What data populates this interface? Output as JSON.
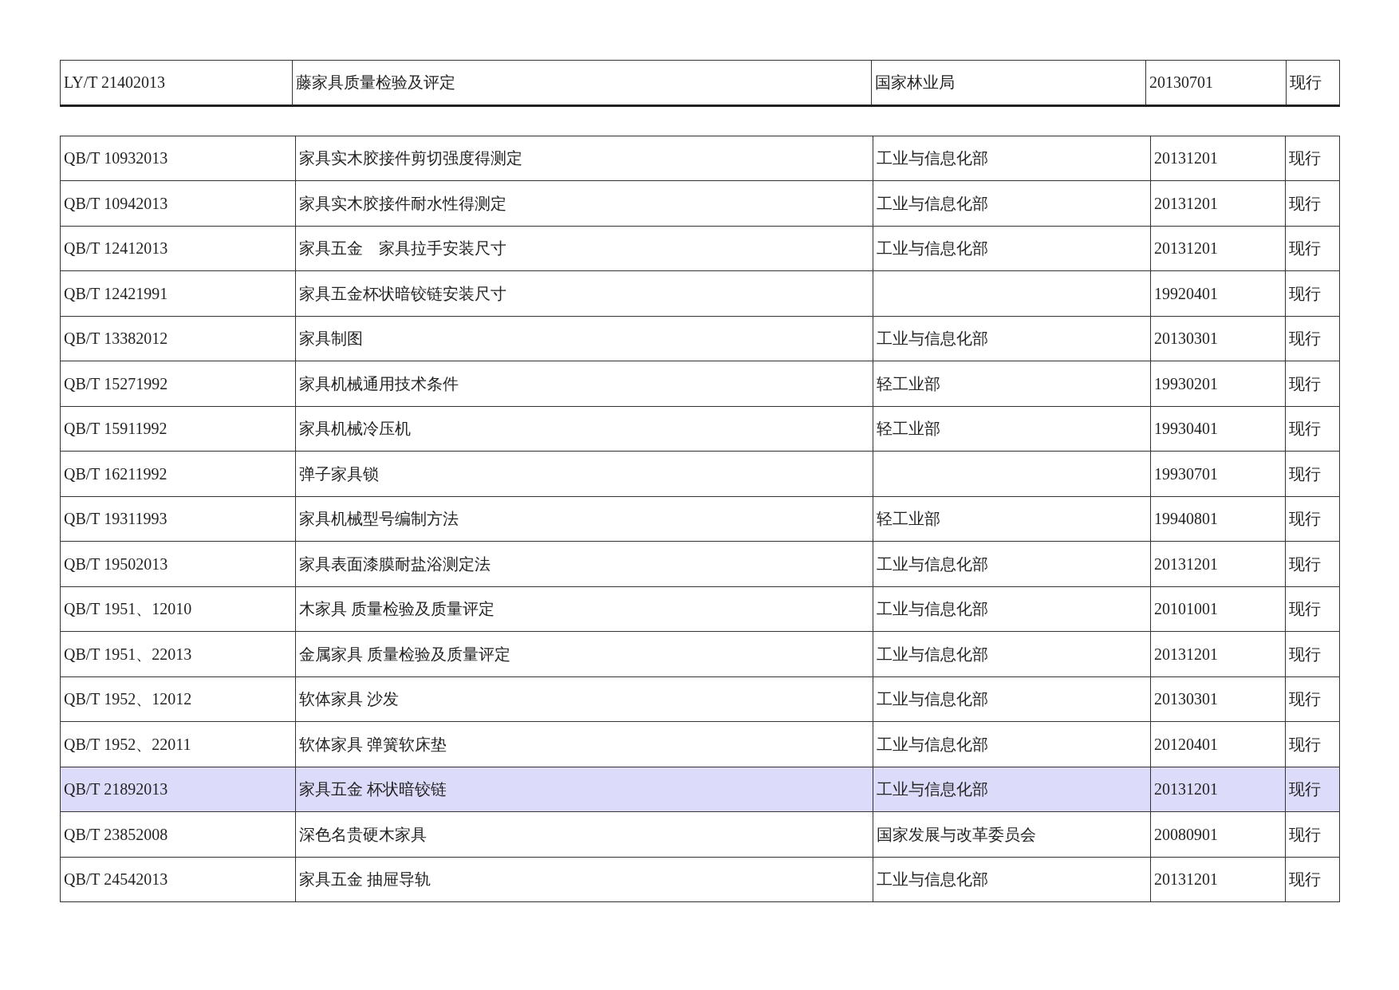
{
  "top_table": {
    "rows": [
      {
        "code": "LY/T 21402013",
        "title": "藤家具质量检验及评定",
        "department": "国家林业局",
        "date": "20130701",
        "status": "现行"
      }
    ]
  },
  "table": {
    "rows": [
      {
        "code": "QB/T 10932013",
        "title": "家具实木胶接件剪切强度得测定",
        "department": "工业与信息化部",
        "date": "20131201",
        "status": "现行",
        "selected": false
      },
      {
        "code": "QB/T 10942013",
        "title": "家具实木胶接件耐水性得测定",
        "department": "工业与信息化部",
        "date": "20131201",
        "status": "现行",
        "selected": false
      },
      {
        "code": "QB/T 12412013",
        "title": "家具五金　家具拉手安装尺寸",
        "department": "工业与信息化部",
        "date": "20131201",
        "status": "现行",
        "selected": false
      },
      {
        "code": "QB/T 12421991",
        "title": "家具五金杯状暗铰链安装尺寸",
        "date": "19920401",
        "status": "现行",
        "selected": false
      },
      {
        "code": "QB/T 13382012",
        "title": "家具制图",
        "department": "工业与信息化部",
        "date": "20130301",
        "status": "现行",
        "selected": false
      },
      {
        "code": "QB/T 15271992",
        "title": "家具机械通用技术条件",
        "department": "轻工业部",
        "date": "19930201",
        "status": "现行",
        "selected": false
      },
      {
        "code": "QB/T 15911992",
        "title": "家具机械冷压机",
        "department": "轻工业部",
        "date": "19930401",
        "status": "现行",
        "selected": false
      },
      {
        "code": "QB/T 16211992",
        "title": "弹子家具锁",
        "date": "19930701",
        "status": "现行",
        "selected": false
      },
      {
        "code": "QB/T 19311993",
        "title": "家具机械型号编制方法",
        "department": "轻工业部",
        "date": "19940801",
        "status": "现行",
        "selected": false
      },
      {
        "code": "QB/T 19502013",
        "title": "家具表面漆膜耐盐浴测定法",
        "department": "工业与信息化部",
        "date": "20131201",
        "status": "现行",
        "selected": false
      },
      {
        "code": "QB/T 1951、12010",
        "title": "木家具 质量检验及质量评定",
        "department": "工业与信息化部",
        "date": "20101001",
        "status": "现行",
        "selected": false
      },
      {
        "code": "QB/T 1951、22013",
        "title": "金属家具 质量检验及质量评定",
        "department": "工业与信息化部",
        "date": "20131201",
        "status": "现行",
        "selected": false
      },
      {
        "code": "QB/T 1952、12012",
        "title": "软体家具 沙发",
        "department": "工业与信息化部",
        "date": "20130301",
        "status": "现行",
        "selected": false
      },
      {
        "code": "QB/T 1952、22011",
        "title": "软体家具 弹簧软床垫",
        "department": "工业与信息化部",
        "date": "20120401",
        "status": "现行",
        "selected": false
      },
      {
        "code": "QB/T 21892013",
        "title": "家具五金 杯状暗铰链",
        "department": "工业与信息化部",
        "date": "20131201",
        "status": "现行",
        "selected": true
      },
      {
        "code": "QB/T 23852008",
        "title": "深色名贵硬木家具",
        "department": "国家发展与改革委员会",
        "date": "20080901",
        "status": "现行",
        "selected": false
      },
      {
        "code": "QB/T 24542013",
        "title": "家具五金 抽屉导轨",
        "department": "工业与信息化部",
        "date": "20131201",
        "status": "现行",
        "selected": false
      }
    ]
  }
}
